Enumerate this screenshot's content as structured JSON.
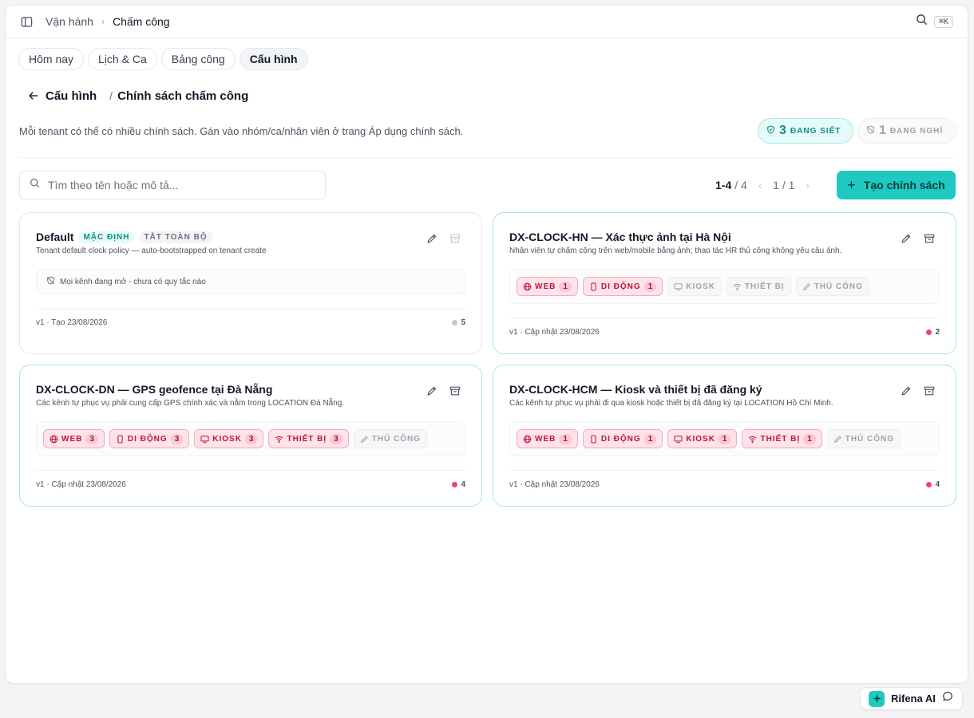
{
  "colors": {
    "accent": "#1fc9c1",
    "accent_text": "#0e8f88",
    "channel_on": "#be123c",
    "dot_active": "#f43f75",
    "dot_default": "#c4c8cd"
  },
  "header": {
    "breadcrumb_parent": "Vận hành",
    "breadcrumb_current": "Chấm công",
    "search_icon": "search-icon",
    "shortcut": "⌘K"
  },
  "tabs": [
    {
      "label": "Hôm nay"
    },
    {
      "label": "Lịch & Ca"
    },
    {
      "label": "Bảng công"
    },
    {
      "label": "Cấu hình",
      "active": true
    }
  ],
  "page": {
    "back_label": "Cấu hình",
    "separator": "/",
    "title": "Chính sách chấm công",
    "description": "Mỗi tenant có thể có nhiều chính sách. Gán vào nhóm/ca/nhân viên ở trang Áp dụng chính sách."
  },
  "stats": {
    "strict_count": "3",
    "strict_label": "ĐANG SIẾT",
    "off_count": "1",
    "off_label": "ĐANG NGHỈ"
  },
  "search": {
    "placeholder": "Tìm theo tên hoặc mô tả..."
  },
  "pagination": {
    "range": "1-4",
    "total": "/ 4",
    "prev": "‹",
    "page": "1 / 1",
    "next": "›"
  },
  "create_button": {
    "label": "Tạo chính sách"
  },
  "cards": [
    {
      "title": "Default",
      "tag_default": "MẶC ĐỊNH",
      "tag_off": "TẮT TOÀN BỘ",
      "description": "Tenant default clock policy — auto-bootstrapped on tenant create",
      "empty_text": "Mọi kênh đang mở - chưa có quy tắc nào",
      "version": "v1 · Tạo 23/08/2026",
      "count": "5"
    },
    {
      "title": "DX-CLOCK-HN — Xác thực ảnh tại Hà Nội",
      "description": "Nhân viên tự chấm công trên web/mobile bằng ảnh; thao tác HR thủ công không yêu cầu ảnh.",
      "channels": [
        {
          "label": "WEB",
          "count": "1",
          "active": true,
          "icon": "globe-icon"
        },
        {
          "label": "DI ĐỘNG",
          "count": "1",
          "active": true,
          "icon": "phone-icon"
        },
        {
          "label": "KIOSK",
          "active": false,
          "icon": "monitor-icon"
        },
        {
          "label": "THIẾT BỊ",
          "active": false,
          "icon": "wifi-icon"
        },
        {
          "label": "THỦ CÔNG",
          "active": false,
          "icon": "pencil-icon"
        }
      ],
      "version": "v1 · Cập nhật 23/08/2026",
      "count": "2"
    },
    {
      "title": "DX-CLOCK-DN — GPS geofence tại Đà Nẵng",
      "description": "Các kênh tự phục vụ phải cung cấp GPS chính xác và nằm trong LOCATION Đà Nẵng.",
      "channels": [
        {
          "label": "WEB",
          "count": "3",
          "active": true,
          "icon": "globe-icon"
        },
        {
          "label": "DI ĐỘNG",
          "count": "3",
          "active": true,
          "icon": "phone-icon"
        },
        {
          "label": "KIOSK",
          "count": "3",
          "active": true,
          "icon": "monitor-icon"
        },
        {
          "label": "THIẾT BỊ",
          "count": "3",
          "active": true,
          "icon": "wifi-icon"
        },
        {
          "label": "THỦ CÔNG",
          "active": false,
          "icon": "pencil-icon"
        }
      ],
      "version": "v1 · Cập nhật 23/08/2026",
      "count": "4"
    },
    {
      "title": "DX-CLOCK-HCM — Kiosk và thiết bị đã đăng ký",
      "description": "Các kênh tự phục vụ phải đi qua kiosk hoặc thiết bị đã đăng ký tại LOCATION Hồ Chí Minh.",
      "channels": [
        {
          "label": "WEB",
          "count": "1",
          "active": true,
          "icon": "globe-icon"
        },
        {
          "label": "DI ĐỘNG",
          "count": "1",
          "active": true,
          "icon": "phone-icon"
        },
        {
          "label": "KIOSK",
          "count": "1",
          "active": true,
          "icon": "monitor-icon"
        },
        {
          "label": "THIẾT BỊ",
          "count": "1",
          "active": true,
          "icon": "wifi-icon"
        },
        {
          "label": "THỦ CÔNG",
          "active": false,
          "icon": "pencil-icon"
        }
      ],
      "version": "v1 · Cập nhật 23/08/2026",
      "count": "4"
    }
  ],
  "assistant": {
    "label": "Rifena AI"
  }
}
